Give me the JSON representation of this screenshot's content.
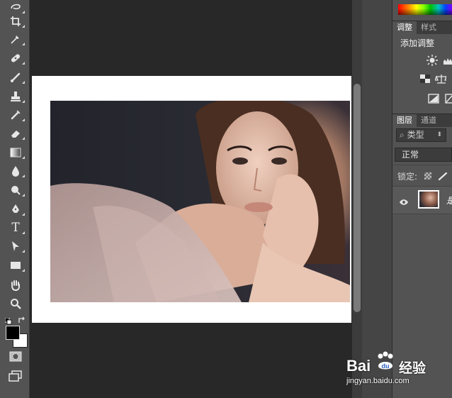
{
  "toolbar": {
    "tools": [
      "lasso-tool",
      "crop-tool",
      "eyedropper-tool",
      "healing-brush-tool",
      "brush-tool",
      "clone-stamp-tool",
      "history-brush-tool",
      "eraser-tool",
      "gradient-tool",
      "blur-tool",
      "dodge-tool",
      "pen-tool",
      "type-tool",
      "path-selection-tool",
      "rectangle-tool",
      "hand-tool",
      "zoom-tool"
    ],
    "type_tool_glyph": "T",
    "foreground_color": "#000000",
    "background_color": "#ffffff"
  },
  "panels": {
    "adjust_tabs": [
      "调整",
      "样式"
    ],
    "adjust_title": "添加调整",
    "layer_tabs": [
      "图层",
      "通道"
    ],
    "filter_label": "类型",
    "blend_mode": "正常",
    "lock_label": "锁定:",
    "layer_name_partial": "是"
  },
  "watermark": {
    "brand_left": "Bai",
    "brand_right": "经验",
    "url": "jingyan.baidu.com"
  }
}
